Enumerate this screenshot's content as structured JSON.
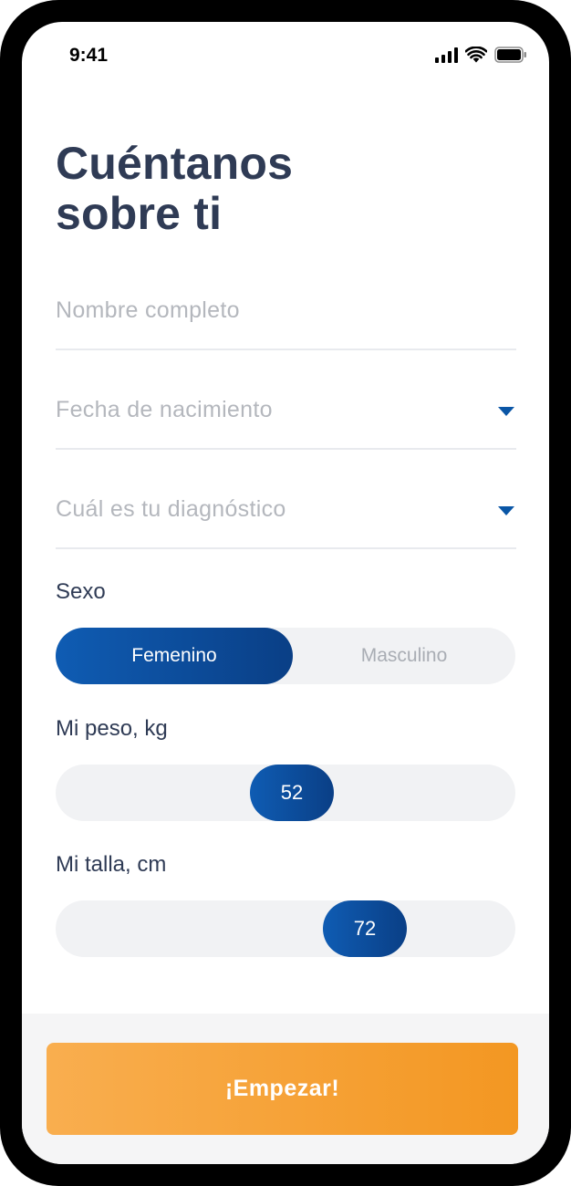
{
  "status_bar": {
    "time": "9:41"
  },
  "title": {
    "line1": "Cuéntanos",
    "line2": "sobre ti"
  },
  "fields": {
    "name_placeholder": "Nombre completo",
    "birthdate_placeholder": "Fecha de nacimiento",
    "diagnosis_placeholder": "Cuál es tu diagnóstico"
  },
  "sex": {
    "label": "Sexo",
    "options": [
      "Femenino",
      "Masculino"
    ],
    "selected": "Femenino"
  },
  "weight": {
    "label": "Mi peso, kg",
    "value": "52"
  },
  "height": {
    "label": "Mi talla, cm",
    "value": "72"
  },
  "cta": {
    "label": "¡Empezar!"
  },
  "colors": {
    "primary": "#0a4c9a",
    "accent": "#f5a236",
    "title": "#2f3b55"
  },
  "icons": [
    "signal-icon",
    "wifi-icon",
    "battery-icon",
    "chevron-down-icon"
  ]
}
